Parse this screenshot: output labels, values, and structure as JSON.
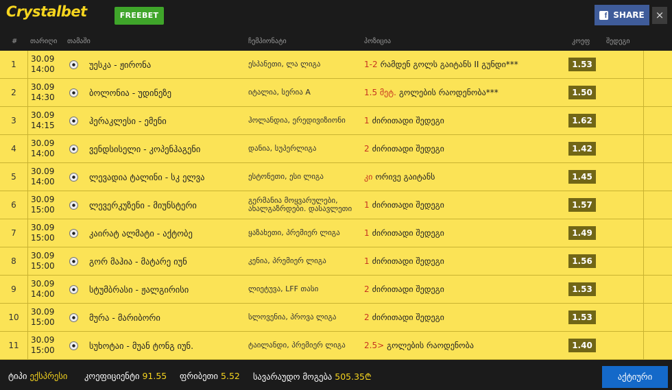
{
  "header": {
    "logo": "Crystalbet",
    "freebet_label": "FREEBET",
    "share_label": "SHARE",
    "close_label": "×"
  },
  "columns": {
    "num": "#",
    "date": "თარიღი",
    "match": "თამაში",
    "league": "ჩემპიონატი",
    "position": "პოზიცია",
    "odds": "კოეფ",
    "result": "შედეგი"
  },
  "rows": [
    {
      "num": "1",
      "date": "30.09",
      "time": "14:00",
      "match": "უესკა - ჟირონა",
      "league": "ესპანეთი, ლა ლიგა",
      "pos_hl": "1-2",
      "pos_text": "რამდენ გოლს გაიტანს II გუნდი***",
      "odds": "1.53"
    },
    {
      "num": "2",
      "date": "30.09",
      "time": "14:30",
      "match": "ბოლონია - უდინეზე",
      "league": "იტალია, სერია A",
      "pos_hl": "1.5 მეტ.",
      "pos_text": "გოლების რაოდენობა***",
      "odds": "1.50"
    },
    {
      "num": "3",
      "date": "30.09",
      "time": "14:15",
      "match": "ჰერაკლესი - ემენი",
      "league": "ჰოლანდია, ერედივიზიონი",
      "pos_hl": "1",
      "pos_text": "ძირითადი შედეგი",
      "odds": "1.62"
    },
    {
      "num": "4",
      "date": "30.09",
      "time": "14:00",
      "match": "ვენდსისელი - კოპენჰაგენი",
      "league": "დანია, სუპერლიგა",
      "pos_hl": "2",
      "pos_text": "ძირითადი შედეგი",
      "odds": "1.42"
    },
    {
      "num": "5",
      "date": "30.09",
      "time": "14:00",
      "match": "ლევადია ტალინი - სკ ელვა",
      "league": "ესტონეთი, ესი ლიგა",
      "pos_hl": "კი",
      "pos_text": "ორივე გაიტანს",
      "odds": "1.45"
    },
    {
      "num": "6",
      "date": "30.09",
      "time": "15:00",
      "match": "ლევერკუზენი - მიუნსტერი",
      "league": "გერმანია მოყვარულები, ახალგაზრდები. დასავლეთი",
      "pos_hl": "1",
      "pos_text": "ძირითადი შედეგი",
      "odds": "1.57"
    },
    {
      "num": "7",
      "date": "30.09",
      "time": "15:00",
      "match": "კაირატ ალმატი - აქტობე",
      "league": "ყაზახეთი, პრემიერ ლიგა",
      "pos_hl": "1",
      "pos_text": "ძირითადი შედეგი",
      "odds": "1.49"
    },
    {
      "num": "8",
      "date": "30.09",
      "time": "15:00",
      "match": "გორ მაჰია - მატარე იუნ",
      "league": "კენია, პრემიერ ლიგა",
      "pos_hl": "1",
      "pos_text": "ძირითადი შედეგი",
      "odds": "1.56"
    },
    {
      "num": "9",
      "date": "30.09",
      "time": "14:00",
      "match": "სტუმბრასი - ჟალგირისი",
      "league": "ლიეტუვა, LFF თასი",
      "pos_hl": "2",
      "pos_text": "ძირითადი შედეგი",
      "odds": "1.53"
    },
    {
      "num": "10",
      "date": "30.09",
      "time": "15:00",
      "match": "მურა - მარიბორი",
      "league": "სლოვენია, პროვა ლიგა",
      "pos_hl": "2",
      "pos_text": "ძირითადი შედეგი",
      "odds": "1.53"
    },
    {
      "num": "11",
      "date": "30.09",
      "time": "15:00",
      "match": "სუხოტაი - მუან ტონგ იუნ.",
      "league": "ტაილანდი, პრემიერ ლიგა",
      "pos_hl": "2.5>",
      "pos_text": "გოლების რაოდენობა",
      "odds": "1.40"
    }
  ],
  "footer": {
    "type_label": "ტიპი",
    "type_value": "ექსპრესი",
    "coef_label": "კოეფიციენტი",
    "coef_value": "91.55",
    "freebet_label": "ფრიბეთი",
    "freebet_value": "5.52",
    "win_label": "სავარაუდო მოგება",
    "win_value": "505.35₾",
    "activate_label": "აქტიური"
  },
  "colors": {
    "row_bg": "#fbe356",
    "highlight": "#c6331f",
    "odds_bg": "#716616",
    "accent": "#f6d51f"
  }
}
